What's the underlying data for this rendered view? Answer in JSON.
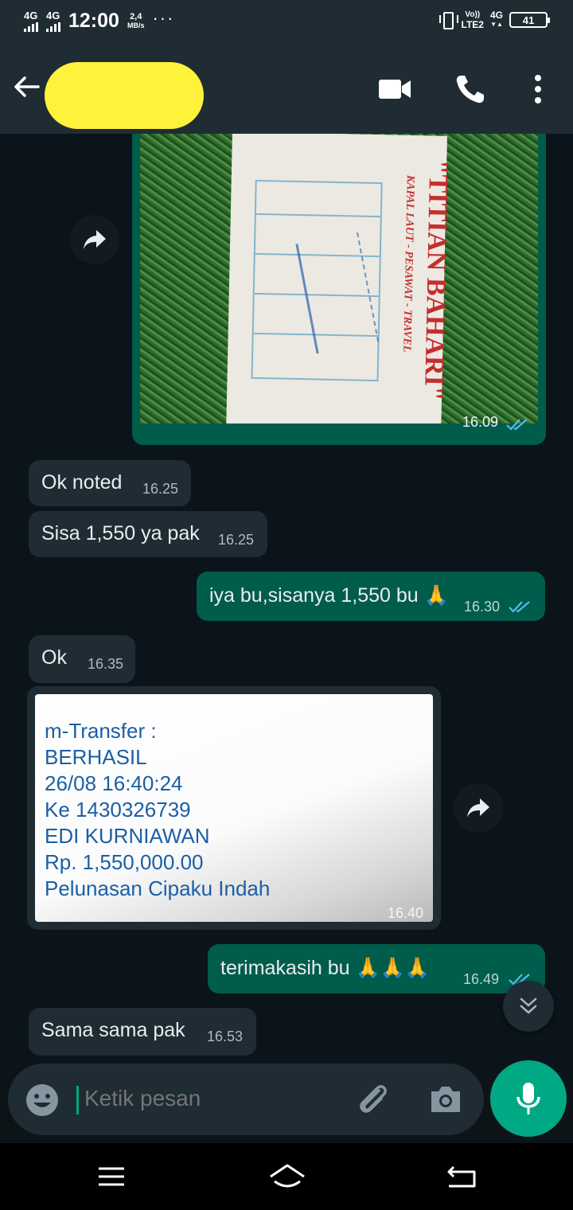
{
  "status_bar": {
    "network1": "4G",
    "network2": "4G",
    "time": "12:00",
    "speed_value": "2,4",
    "speed_unit": "MB/s",
    "more": "···",
    "volte": "Vo))",
    "lte": "LTE2",
    "net_right": "4G",
    "battery": "41"
  },
  "header": {
    "contact_name_redacted": true,
    "icons": [
      "back-arrow-icon",
      "video-call-icon",
      "phone-call-icon",
      "more-vert-icon"
    ]
  },
  "messages": [
    {
      "type": "image",
      "direction": "out",
      "time": "16.09",
      "status": "read",
      "image_text": {
        "company": "\"TITIAN BAHARI\"",
        "subtitle": "KAPAL LAUT - PESAWAT - TRAVEL"
      }
    },
    {
      "type": "text",
      "direction": "in",
      "text": "Ok noted",
      "time": "16.25"
    },
    {
      "type": "text",
      "direction": "in",
      "text": "Sisa 1,550 ya pak",
      "time": "16.25"
    },
    {
      "type": "text",
      "direction": "out",
      "text": "iya bu,sisanya 1,550 bu 🙏",
      "time": "16.30",
      "status": "read"
    },
    {
      "type": "text",
      "direction": "in",
      "text": "Ok",
      "time": "16.35"
    },
    {
      "type": "image",
      "direction": "in",
      "time": "16.40",
      "image_text": [
        "m-Transfer :",
        "BERHASIL",
        "26/08 16:40:24",
        "Ke 1430326739",
        "EDI KURNIAWAN",
        "Rp. 1,550,000.00",
        "Pelunasan Cipaku Indah"
      ]
    },
    {
      "type": "text",
      "direction": "out",
      "text": "terimakasih bu 🙏🙏🙏",
      "time": "16.49",
      "status": "read"
    },
    {
      "type": "text",
      "direction": "in",
      "text": "Sama sama pak",
      "time": "16.53"
    }
  ],
  "input": {
    "placeholder": "Ketik pesan"
  },
  "colors": {
    "background": "#0b141a",
    "header": "#1f2c34",
    "incoming_bubble": "#1f2c34",
    "outgoing_bubble": "#005c4b",
    "accent": "#00a884",
    "read_ticks": "#53bdeb",
    "redaction": "#fff23a"
  }
}
